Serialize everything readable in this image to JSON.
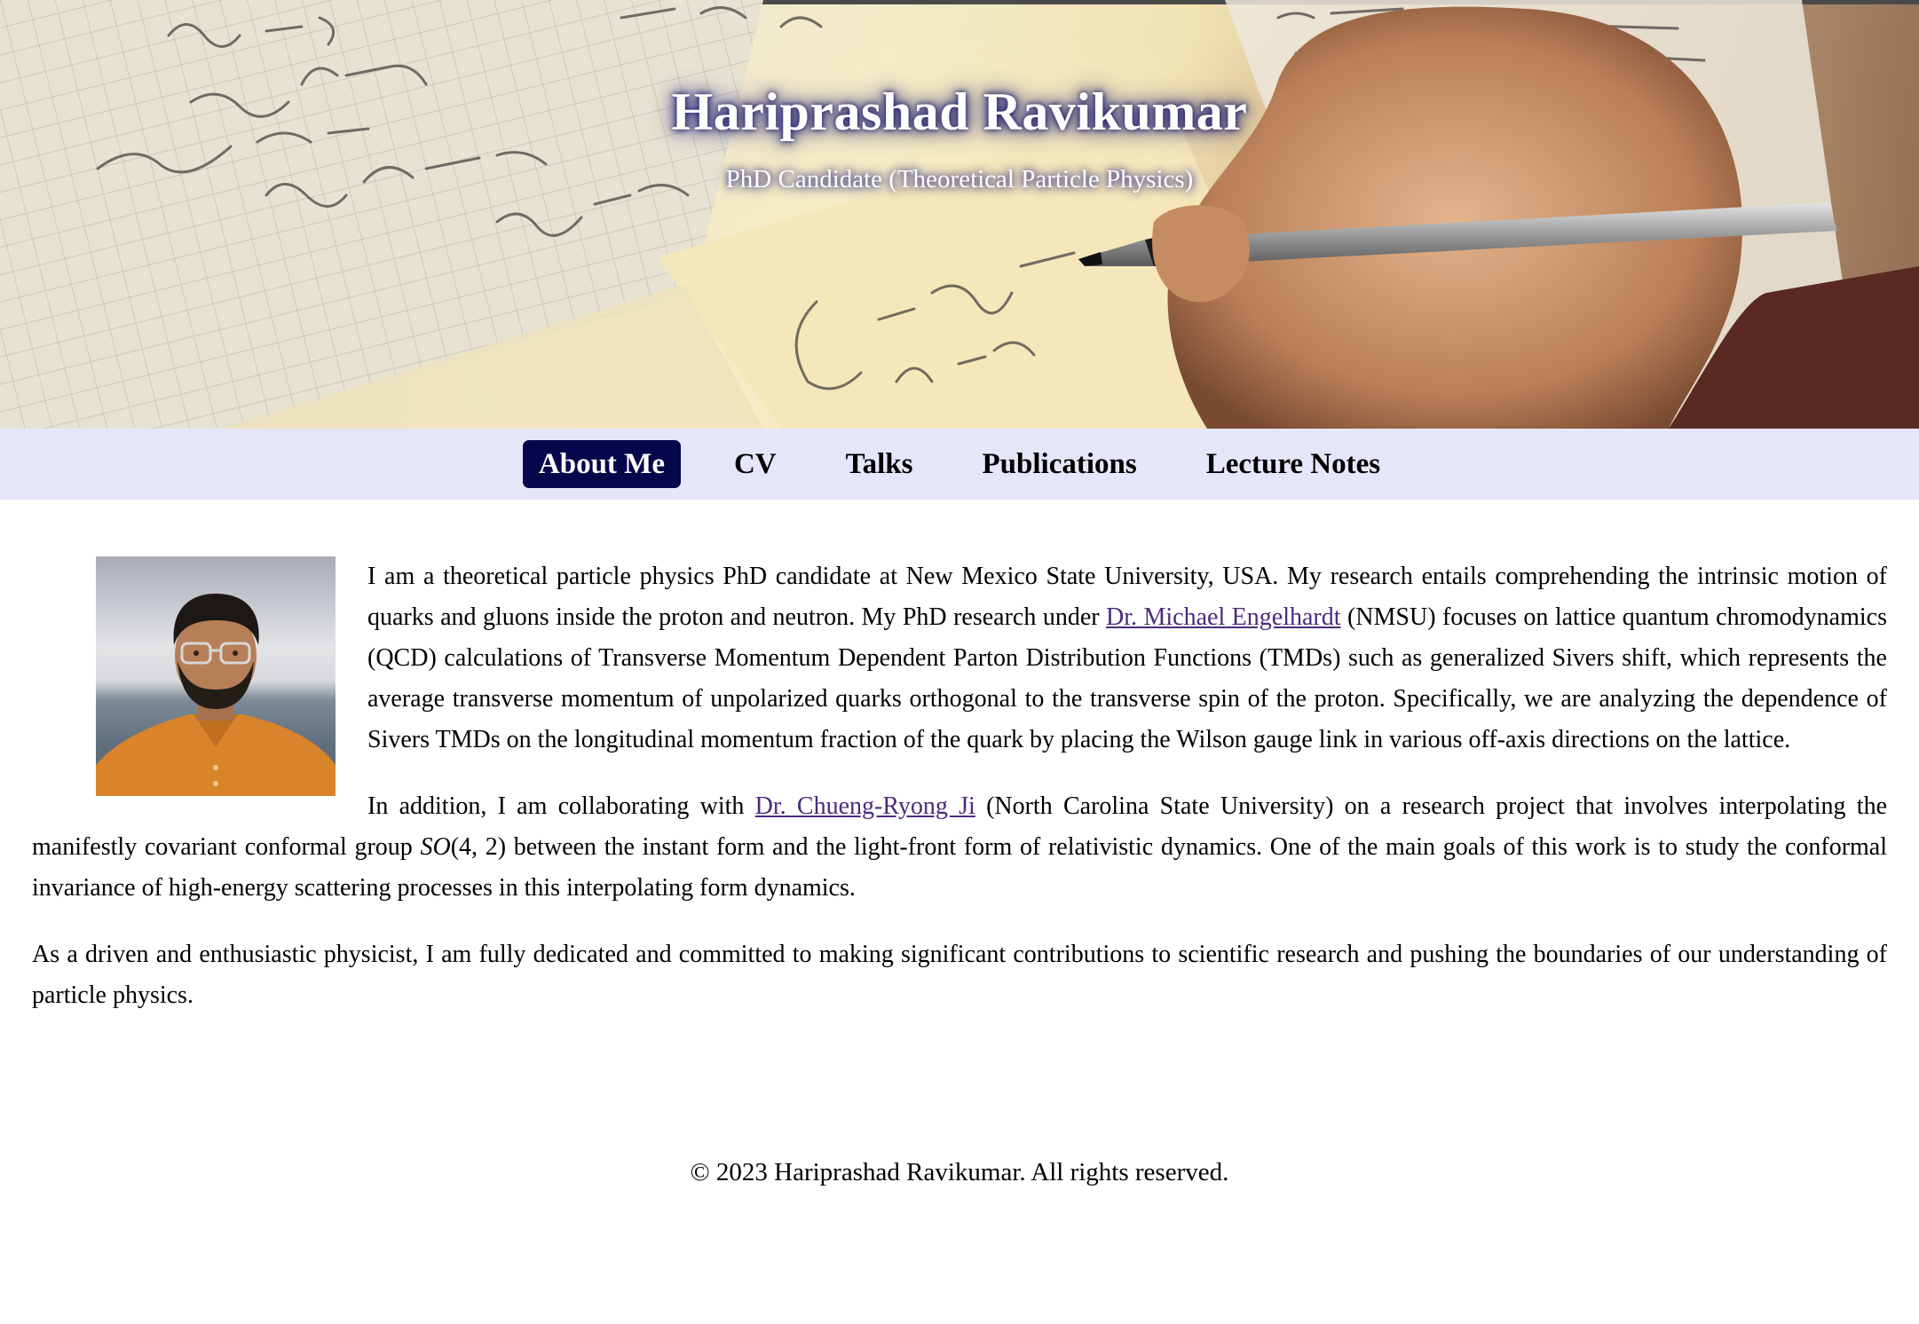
{
  "header": {
    "title": "Hariprashad Ravikumar",
    "subtitle": "PhD Candidate (Theoretical Particle Physics)",
    "background_image": "hand-writing-physics-equations"
  },
  "nav": {
    "items": [
      {
        "label": "About Me",
        "active": true
      },
      {
        "label": "CV",
        "active": false
      },
      {
        "label": "Talks",
        "active": false
      },
      {
        "label": "Publications",
        "active": false
      },
      {
        "label": "Lecture Notes",
        "active": false
      }
    ],
    "background_color": "#e6e6fa",
    "active_color": "#06064a"
  },
  "about": {
    "photo_alt": "profile-photo",
    "p1": {
      "before_link": "I am a theoretical particle physics PhD candidate at New Mexico State University, USA. My research entails comprehending the intrinsic motion of quarks and gluons inside the proton and neutron. My PhD research under ",
      "link": "Dr. Michael Engelhardt",
      "after_link": " (NMSU) focuses on lattice quantum chromodynamics (QCD) calculations of Transverse Momentum Dependent Parton Distribution Functions (TMDs) such as generalized Sivers shift, which represents the average transverse momentum of unpolarized quarks orthogonal to the transverse spin of the proton. Specifically, we are analyzing the dependence of Sivers TMDs on the longitudinal momentum fraction of the quark by placing the Wilson gauge link in various off-axis directions on the lattice."
    },
    "p2": {
      "before_link": "In addition, I am collaborating with ",
      "link": "Dr. Chueng-Ryong Ji",
      "middle": " (North Carolina State University) on a research project that involves interpolating the manifestly covariant conformal group ",
      "math_group": "SO",
      "math_args": "(4, 2)",
      "after_math": " between the instant form and the light-front form of relativistic dynamics. One of the main goals of this work is to study the conformal invariance of high-energy scattering processes in this interpolating form dynamics."
    },
    "p3": "As a driven and enthusiastic physicist, I am fully dedicated and committed to making significant contributions to scientific research and pushing the boundaries of our understanding of particle physics.",
    "link_color": "#4b2a7e"
  },
  "footer": {
    "text": "© 2023 Hariprashad Ravikumar. All rights reserved."
  }
}
